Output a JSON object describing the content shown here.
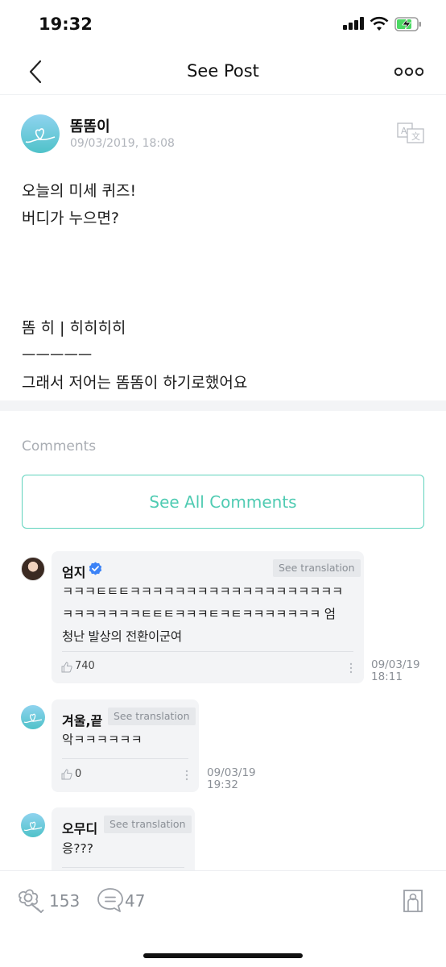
{
  "status_bar": {
    "time": "19:32"
  },
  "header": {
    "title": "See Post"
  },
  "post": {
    "author": "똠똠이",
    "date": "09/03/2019, 18:08",
    "lines": [
      "오늘의 미세 퀴즈!",
      "버디가 누으면?",
      "",
      "",
      "",
      "똠 히 | 히히히히",
      "ㅡㅡㅡㅡㅡ",
      "그래서 저어는 똠똠이 하기로했어요"
    ]
  },
  "comments_section": {
    "label": "Comments",
    "see_all_label": "See All Comments"
  },
  "see_translation_label": "See translation",
  "comments": [
    {
      "author": "엄지",
      "verified": true,
      "lines": [
        "ㅋㅋㅋㅌㅌㅌㅋㅋㅋㅋㅋㅋㅋㅋㅋㅋㅋㅋㅋㅋㅋㅋㅋㅋㅋ",
        "ㅋㅋㅋㅋㅋㅋㅋㅌㅌㅌㅋㅋㅋㅌㅋㅌㅋㅋㅋㅋㅋㅋㅋ 엄",
        "청난 발상의 전환이군여"
      ],
      "likes": "740",
      "time_date": "09/03/19",
      "time_clock": "18:11"
    },
    {
      "author": "겨울,끝",
      "verified": false,
      "lines": [
        "악ㅋㅋㅋㅋㅋㅋ"
      ],
      "likes": "0",
      "time_date": "09/03/19",
      "time_clock": "19:32"
    },
    {
      "author": "오무디",
      "verified": false,
      "lines": [
        "응???"
      ],
      "likes": "",
      "time_date": "",
      "time_clock": ""
    }
  ],
  "bottom_bar": {
    "like_count": "153",
    "comment_count": "47"
  },
  "colors": {
    "accent": "#4fcbb2",
    "muted": "#a9adb3",
    "bubble": "#f3f4f6",
    "verified": "#3b82f6"
  }
}
